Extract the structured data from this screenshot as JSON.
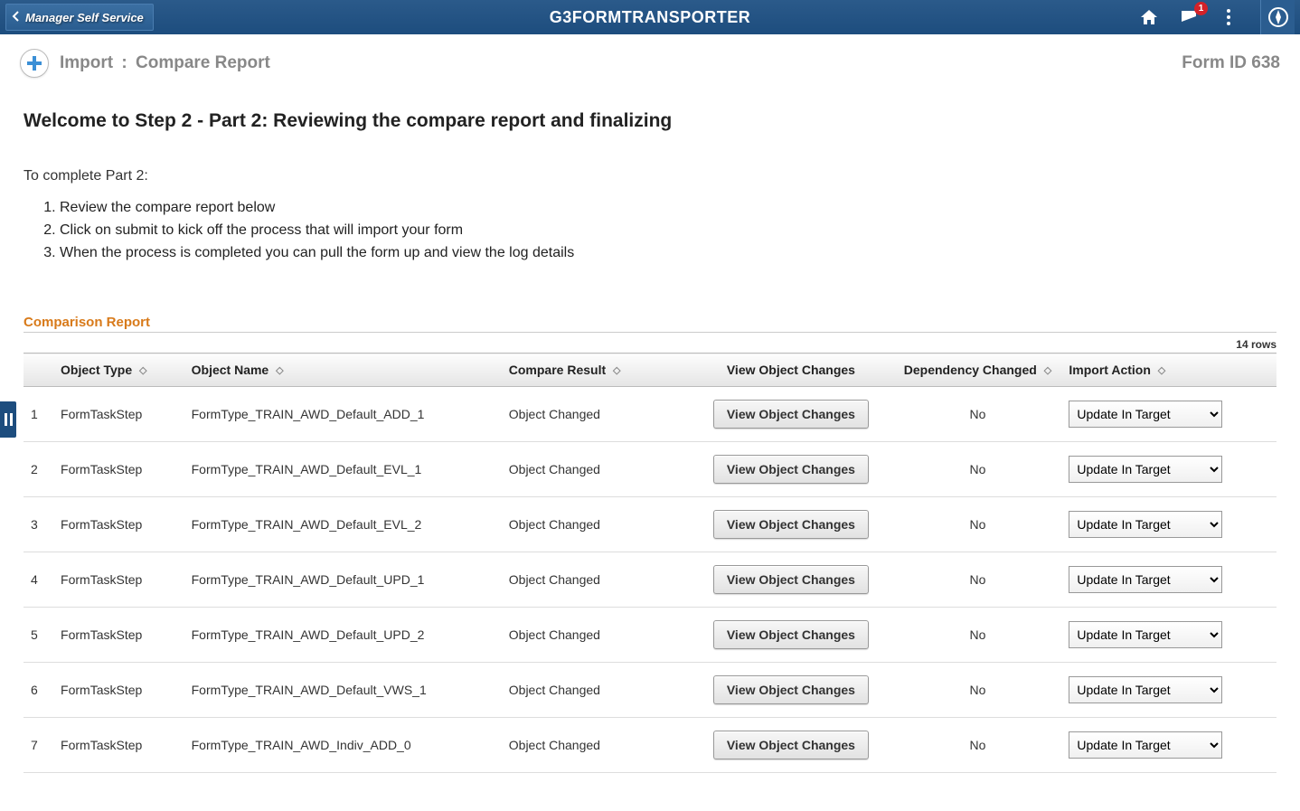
{
  "header": {
    "back_label": "Manager Self Service",
    "app_title": "G3FORMTRANSPORTER",
    "notification_count": "1"
  },
  "subheader": {
    "crumb1": "Import",
    "crumb_sep": ":",
    "crumb2": "Compare Report",
    "form_id_label": "Form ID",
    "form_id_value": "638"
  },
  "page": {
    "welcome": "Welcome to Step 2 - Part 2: Reviewing the compare report and finalizing",
    "instr_lead": "To complete Part 2:",
    "instr1": "Review the compare report below",
    "instr2": "Click on submit to kick off the process that will import your form",
    "instr3": "When the process is completed you can pull the form up and view the log details",
    "section_title": "Comparison Report",
    "rows_count": "14 rows"
  },
  "table": {
    "col_num": "",
    "col_objtype": "Object Type",
    "col_objname": "Object Name",
    "col_compres": "Compare Result",
    "col_viewchg": "View Object Changes",
    "col_dep": "Dependency Changed",
    "col_action": "Import Action",
    "view_btn": "View Object Changes",
    "action_default": "Update In Target",
    "rows": [
      {
        "n": "1",
        "type": "FormTaskStep",
        "name": "FormType_TRAIN_AWD_Default_ADD_1",
        "result": "Object Changed",
        "dep": "No"
      },
      {
        "n": "2",
        "type": "FormTaskStep",
        "name": "FormType_TRAIN_AWD_Default_EVL_1",
        "result": "Object Changed",
        "dep": "No"
      },
      {
        "n": "3",
        "type": "FormTaskStep",
        "name": "FormType_TRAIN_AWD_Default_EVL_2",
        "result": "Object Changed",
        "dep": "No"
      },
      {
        "n": "4",
        "type": "FormTaskStep",
        "name": "FormType_TRAIN_AWD_Default_UPD_1",
        "result": "Object Changed",
        "dep": "No"
      },
      {
        "n": "5",
        "type": "FormTaskStep",
        "name": "FormType_TRAIN_AWD_Default_UPD_2",
        "result": "Object Changed",
        "dep": "No"
      },
      {
        "n": "6",
        "type": "FormTaskStep",
        "name": "FormType_TRAIN_AWD_Default_VWS_1",
        "result": "Object Changed",
        "dep": "No"
      },
      {
        "n": "7",
        "type": "FormTaskStep",
        "name": "FormType_TRAIN_AWD_Indiv_ADD_0",
        "result": "Object Changed",
        "dep": "No"
      }
    ]
  }
}
